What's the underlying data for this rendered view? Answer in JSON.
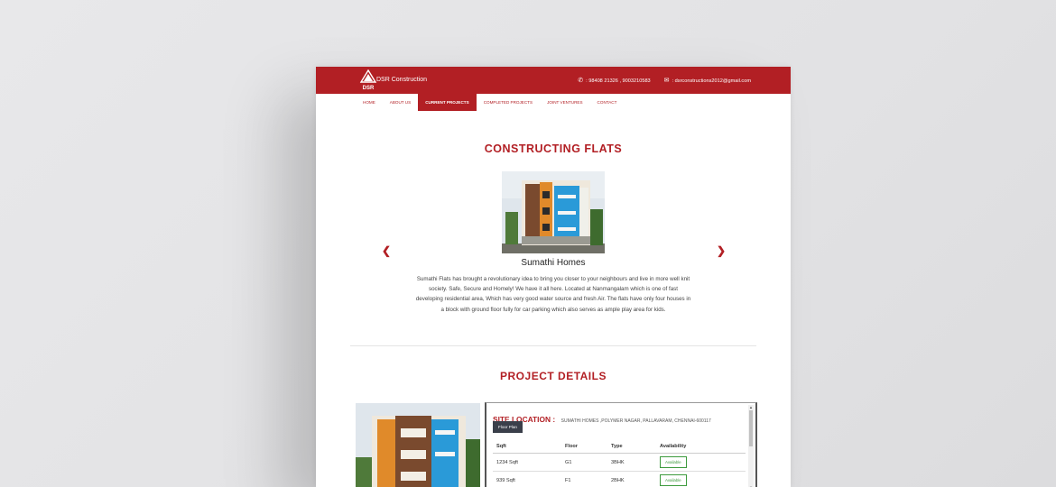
{
  "header": {
    "logo_text": "DSR Construction",
    "logo_mark": "DSR",
    "phone_icon": "phone-icon",
    "phone": ": 98408 21326 , 9003210583",
    "mail_icon": "envelope-icon",
    "email": ": dsrconstructions2012@gmail.com"
  },
  "nav": {
    "items": [
      {
        "label": "HOME"
      },
      {
        "label": "ABOUT US"
      },
      {
        "label": "CURRENT PROJECTS"
      },
      {
        "label": "COMPLETED PROJECTS"
      },
      {
        "label": "JOINT VENTURES"
      },
      {
        "label": "CONTACT"
      }
    ],
    "active": "CURRENT PROJECTS"
  },
  "section1": {
    "title": "CONSTRUCTING FLATS",
    "prev_icon": "chevron-left-icon",
    "next_icon": "chevron-right-icon",
    "project_name": "Sumathi Homes",
    "description": "Sumathi Flats has brought a revolutionary idea to bring you closer to your neighbours and live in more well knit society. Safe, Secure and Homely! We have it all here. Located at Nanmangalam which is one of fast developing residential area, Which has very good water source and fresh Air. The flats have only four houses in a block with ground floor fully for car parking which also serves as ample play area for kids."
  },
  "section2": {
    "title": "PROJECT DETAILS",
    "site_location_label": "SITE LOCATION :",
    "site_location_value": "SUMATHI HOMES ,POLYMER NAGAR, PALLAVARAM, CHENNAI-600117",
    "floor_plan_button": "Floor Plan",
    "columns": [
      "Sqft",
      "Floor",
      "Type",
      "Availability"
    ],
    "rows": [
      {
        "sqft": "1234 Sqft",
        "floor": "G1",
        "type": "3BHK",
        "availability": "Available"
      },
      {
        "sqft": "939 Sqft",
        "floor": "F1",
        "type": "2BHK",
        "availability": "Available"
      }
    ]
  },
  "colors": {
    "brand_red": "#b21f24",
    "available_green": "#3c9a3c"
  }
}
